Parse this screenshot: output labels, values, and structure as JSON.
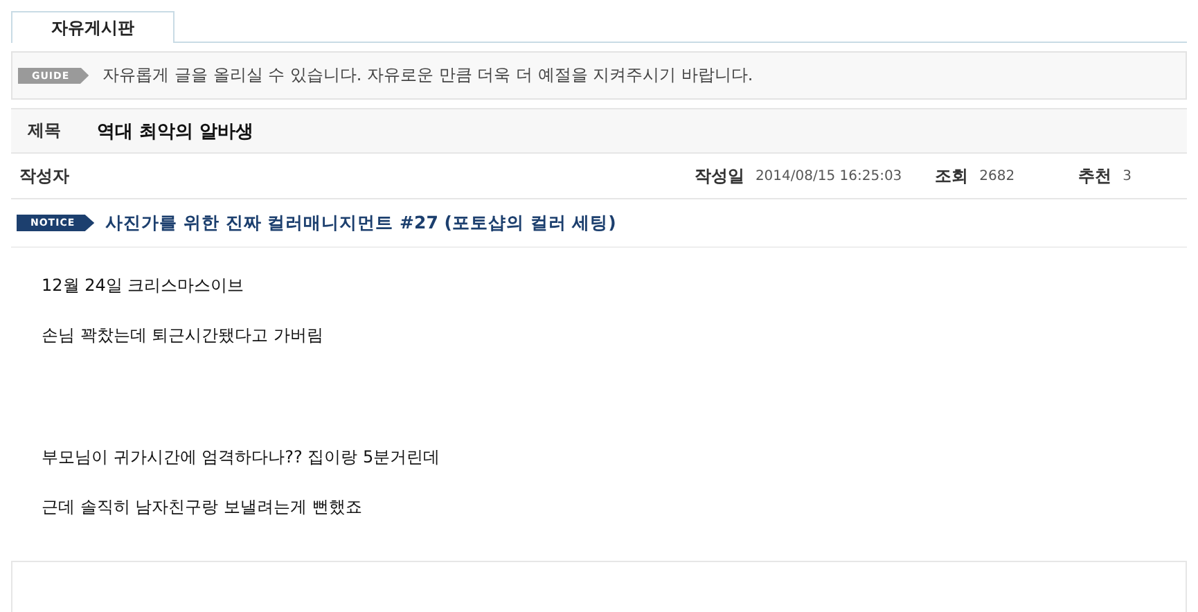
{
  "tabs": [
    {
      "label": "자유게시판",
      "selected": true
    }
  ],
  "guide": {
    "badge": "GUIDE",
    "text": "자유롭게 글을 올리실 수 있습니다. 자유로운 만큼 더욱 더 예절을 지켜주시기 바랍니다."
  },
  "post": {
    "title_label": "제목",
    "title": "역대 최악의 알바생",
    "author_label": "작성자",
    "meta": [
      {
        "label": "작성일",
        "value": "2014/08/15 16:25:03"
      },
      {
        "label": "조회",
        "value": "2682"
      },
      {
        "label": "추천",
        "value": "3"
      }
    ]
  },
  "notice": {
    "badge": "NOTICE",
    "link": "사진가를 위한 진짜 컬러매니지먼트 #27 (포토샵의 컬러 세팅)"
  },
  "body": [
    "12월 24일 크리스마스이브",
    "손님 꽉찼는데 퇴근시간됐다고 가버림",
    "부모님이 귀가시간에 엄격하다나?? 집이랑 5분거린데",
    "근데 솔직히 남자친구랑 보낼려는게 뻔했죠"
  ]
}
